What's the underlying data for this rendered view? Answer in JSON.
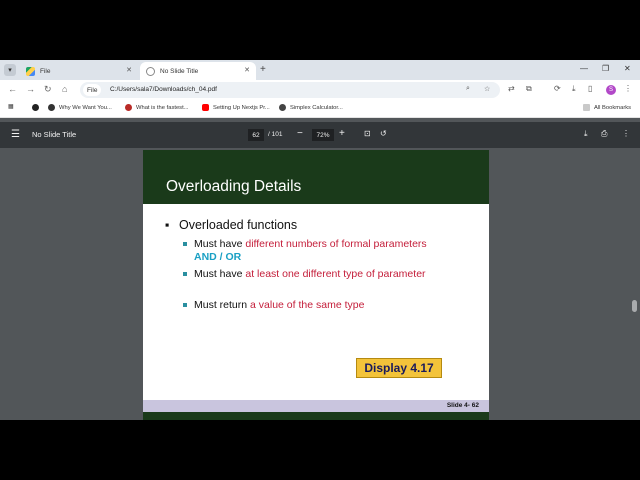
{
  "browser": {
    "tabs": [
      {
        "label": "File"
      },
      {
        "label": "No Slide Title"
      }
    ],
    "new_tab": "+",
    "omnibox": {
      "chip": "File",
      "url": "C:/Users/sala7/Downloads/ch_04.pdf"
    },
    "profile_initial": "S",
    "bookmarks": [
      {
        "label": "Why We Want You..."
      },
      {
        "label": "What is the fastest..."
      },
      {
        "label": "Setting Up Nextjs Pr..."
      },
      {
        "label": "Simplex Calculator..."
      }
    ],
    "all_bookmarks": "All Bookmarks"
  },
  "pdf": {
    "title": "No Slide Title",
    "page_current": "62",
    "page_total": "/ 101",
    "zoom": "72%"
  },
  "slide": {
    "title": "Overloading Details",
    "bullet": "Overloaded functions",
    "sub1_black": "Must have ",
    "sub1_red": "different numbers of formal parameters",
    "sub1_or": "AND / OR",
    "sub2_black": "Must have ",
    "sub2_red": "at least one different type of parameter",
    "sub3_black": "Must return ",
    "sub3_red": "a value of the same type",
    "display_label": "Display 4.17",
    "slide_number": "Slide 4- 62"
  },
  "colors": {
    "accent_green": "#1a3a1a",
    "highlight_red": "#c41e3a",
    "teal": "#1aa0c4",
    "display_yellow": "#f3c33a"
  }
}
